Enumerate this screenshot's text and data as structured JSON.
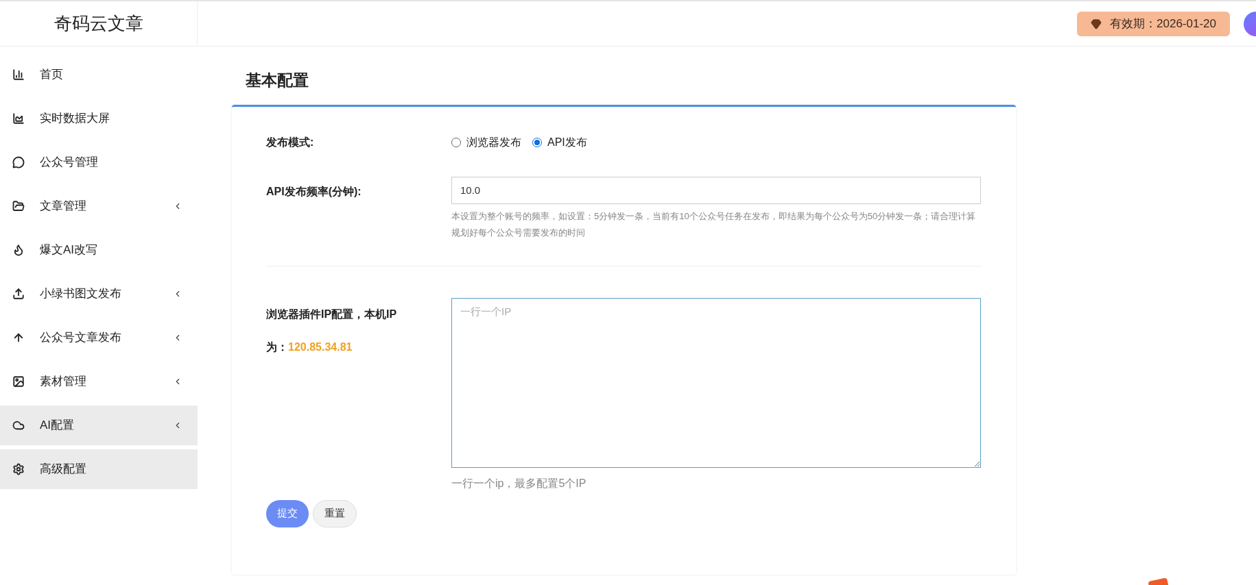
{
  "brand": "奇码云文章",
  "expiry_badge": "有效期：2026-01-20",
  "sidebar": {
    "items": [
      {
        "label": "首页",
        "expandable": false,
        "selected": false
      },
      {
        "label": "实时数据大屏",
        "expandable": false,
        "selected": false
      },
      {
        "label": "公众号管理",
        "expandable": false,
        "selected": false
      },
      {
        "label": "文章管理",
        "expandable": true,
        "selected": false
      },
      {
        "label": "爆文AI改写",
        "expandable": false,
        "selected": false
      },
      {
        "label": "小绿书图文发布",
        "expandable": true,
        "selected": false
      },
      {
        "label": "公众号文章发布",
        "expandable": true,
        "selected": false
      },
      {
        "label": "素材管理",
        "expandable": true,
        "selected": false
      },
      {
        "label": "AI配置",
        "expandable": true,
        "selected": true
      },
      {
        "label": "高级配置",
        "expandable": false,
        "selected": true
      }
    ]
  },
  "page_title": "基本配置",
  "form": {
    "publish_mode": {
      "label": "发布模式:",
      "options": [
        {
          "label": "浏览器发布",
          "selected": false
        },
        {
          "label": "API发布",
          "selected": true
        }
      ]
    },
    "api_frequency": {
      "label": "API发布频率(分钟):",
      "value": "10.0",
      "help": "本设置为整个账号的频率，如设置：5分钟发一条，当前有10个公众号任务在发布，即结果为每个公众号为50分钟发一条；请合理计算规划好每个公众号需要发布的时间"
    },
    "ip_config": {
      "label": "浏览器插件IP配置，本机IP",
      "label_suffix": "为：",
      "local_ip": "120.85.34.81",
      "placeholder": "一行一个IP",
      "help": "一行一个ip，最多配置5个IP"
    },
    "buttons": [
      {
        "label": "提交",
        "kind": "primary"
      },
      {
        "label": "重置",
        "kind": "secondary"
      }
    ]
  }
}
